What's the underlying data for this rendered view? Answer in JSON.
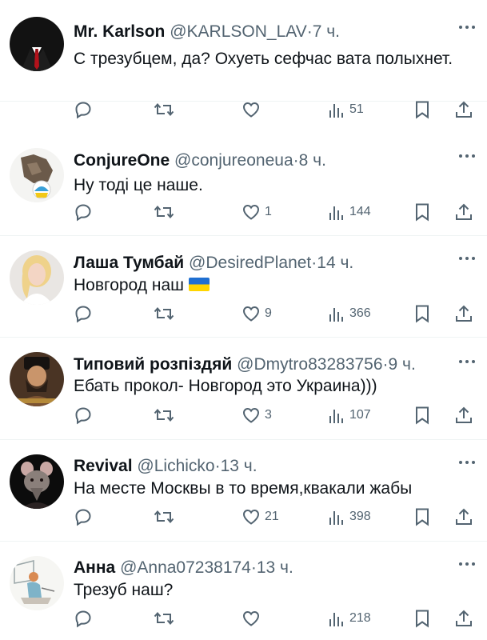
{
  "tweets": [
    {
      "name": "Mr. Karlson",
      "handle": "@KARLSON_LAV",
      "dot": "·",
      "time": "7 ч.",
      "text": "С трезубцем, да? Охуеть сефчас вата полыхнет.",
      "replies": "",
      "retweets": "",
      "likes": "",
      "views": "51",
      "avatar": "suit-avatar"
    },
    {
      "name": "ConjureOne",
      "handle": "@conjureoneua",
      "dot": "·",
      "time": "8 ч.",
      "text": "Ну тоді це наше.",
      "replies": "",
      "retweets": "",
      "likes": "1",
      "views": "144",
      "avatar": "cartoon-avatar"
    },
    {
      "name": "Лаша Тумбай",
      "handle": "@DesiredPlanet",
      "dot": "·",
      "time": "14 ч.",
      "text": "Новгород наш",
      "emoji": "ukraine-flag",
      "replies": "",
      "retweets": "",
      "likes": "9",
      "views": "366",
      "avatar": "blonde-avatar"
    },
    {
      "name": "Типовий розпіздяй",
      "handle": "@Dmytro83283756",
      "dot": "·",
      "time": "9 ч.",
      "text": "Ебать прокол- Новгород это Украина)))",
      "replies": "",
      "retweets": "",
      "likes": "3",
      "views": "107",
      "avatar": "cossack-avatar"
    },
    {
      "name": "Revival",
      "handle": "@Lichicko",
      "dot": "·",
      "time": "13 ч.",
      "text": "На месте Москвы в то время,квакали жабы",
      "replies": "",
      "retweets": "",
      "likes": "21",
      "views": "398",
      "avatar": "rat-avatar"
    },
    {
      "name": "Анна",
      "handle": "@Anna07238174",
      "dot": "·",
      "time": "13 ч.",
      "text": "Трезуб наш?",
      "replies": "",
      "retweets": "",
      "likes": "",
      "views": "218",
      "avatar": "sketch-avatar"
    }
  ],
  "colors": {
    "text": "#0f1419",
    "secondary": "#536471",
    "divider": "#eff3f4"
  }
}
